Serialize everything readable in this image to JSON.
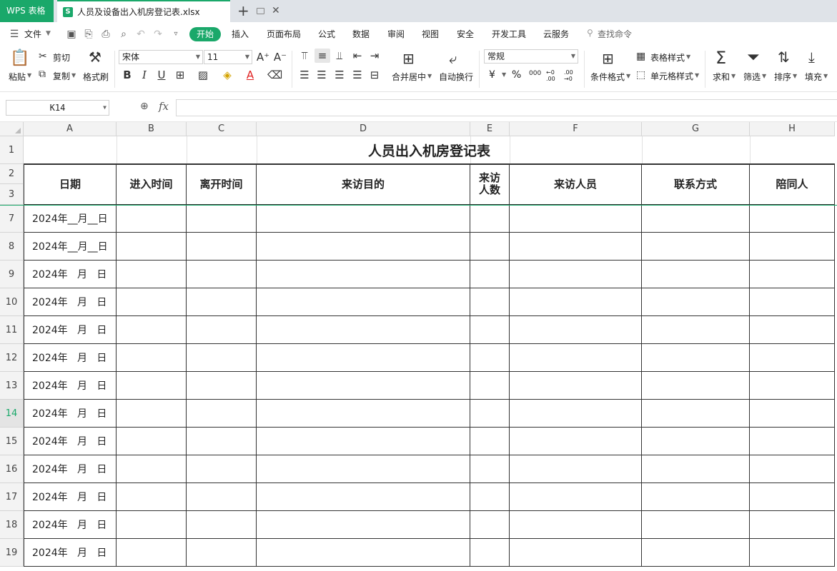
{
  "tabs": {
    "app_label": "WPS 表格",
    "file_name": "人员及设备出入机房登记表.xlsx",
    "file_icon_letter": "S",
    "new_tab": "+"
  },
  "menu": {
    "file": "文件",
    "items": [
      "开始",
      "插入",
      "页面布局",
      "公式",
      "数据",
      "审阅",
      "视图",
      "安全",
      "开发工具",
      "云服务"
    ],
    "search": "查找命令"
  },
  "ribbon": {
    "paste": "粘贴",
    "cut": "剪切",
    "copy": "复制",
    "format_painter": "格式刷",
    "font_name": "宋体",
    "font_size": "11",
    "merge_center": "合并居中",
    "wrap_text": "自动换行",
    "number_format": "常规",
    "currency_symbol": "¥",
    "percent_symbol": "%",
    "thousands_symbol": "000",
    "decimal_increase": ".00",
    "decimal_decrease": ".00",
    "conditional_format": "条件格式",
    "table_style": "表格样式",
    "cell_style": "单元格样式",
    "sum": "求和",
    "filter": "筛选",
    "sort": "排序",
    "fill": "填充"
  },
  "formula_bar": {
    "cell_ref": "K14",
    "fx": "fx",
    "value": ""
  },
  "sheet": {
    "columns": [
      "A",
      "B",
      "C",
      "D",
      "E",
      "F",
      "G",
      "H"
    ],
    "row_numbers": [
      "1",
      "2",
      "3",
      "7",
      "8",
      "9",
      "10",
      "11",
      "12",
      "13",
      "14",
      "15",
      "16",
      "17",
      "18",
      "19"
    ],
    "active_row": "14",
    "title": "人员出入机房登记表",
    "headers": [
      "日期",
      "进入时间",
      "离开时间",
      "来访目的",
      "来访\n人数",
      "来访人员",
      "联系方式",
      "陪同人"
    ],
    "dates": [
      "2024年__月__日",
      "2024年__月__日",
      "2024年   月   日",
      "2024年   月   日",
      "2024年   月   日",
      "2024年   月   日",
      "2024年   月   日",
      "2024年   月   日",
      "2024年   月   日",
      "2024年   月   日",
      "2024年   月   日",
      "2024年   月   日",
      "2024年   月   日"
    ]
  }
}
